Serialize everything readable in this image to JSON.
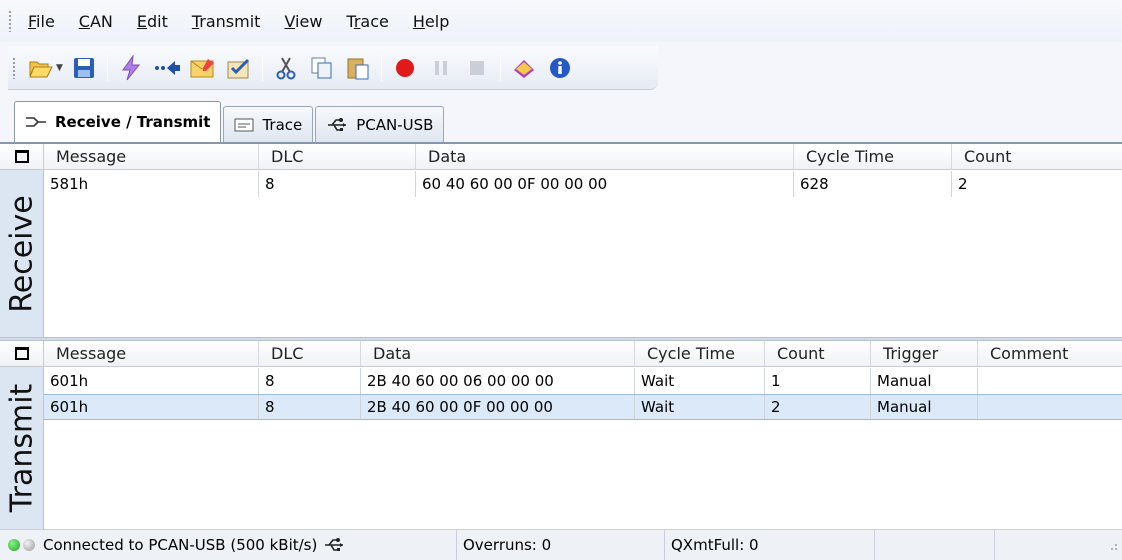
{
  "menu": [
    {
      "label": "File",
      "key": "F",
      "rest": "ile"
    },
    {
      "label": "CAN",
      "key": "C",
      "rest": "AN"
    },
    {
      "label": "Edit",
      "key": "E",
      "rest": "dit"
    },
    {
      "label": "Transmit",
      "key": "T",
      "rest": "ransmit"
    },
    {
      "label": "View",
      "key": "V",
      "rest": "iew"
    },
    {
      "label": "Trace",
      "key": "T",
      "rest": "race",
      "prefix": ""
    },
    {
      "label": "Help",
      "key": "H",
      "rest": "elp"
    }
  ],
  "menu_labels": {
    "file_key": "F",
    "file_rest": "ile",
    "can_key": "C",
    "can_rest": "AN",
    "edit_key": "E",
    "edit_rest": "dit",
    "transmit_key": "T",
    "transmit_rest": "ransmit",
    "view_key": "V",
    "view_rest": "iew",
    "trace_pre": "T",
    "trace_key": "r",
    "trace_rest": "ace",
    "help_key": "H",
    "help_rest": "elp"
  },
  "toolbar": {
    "icons": [
      "open-icon",
      "save-icon",
      "connect-icon",
      "new-message-icon",
      "edit-message-icon",
      "properties-icon",
      "cut-icon",
      "copy-icon",
      "paste-icon",
      "record-icon",
      "pause-icon",
      "stop-icon",
      "help-book-icon",
      "info-icon"
    ]
  },
  "tabs": [
    {
      "label": "Receive / Transmit",
      "icon": "receive-transmit-icon",
      "active": true
    },
    {
      "label": "Trace",
      "icon": "trace-icon",
      "active": false
    },
    {
      "label": "PCAN-USB",
      "icon": "usb-icon",
      "active": false
    }
  ],
  "receive": {
    "side_label": "Receive",
    "columns": [
      "Message",
      "DLC",
      "Data",
      "Cycle Time",
      "Count"
    ],
    "rows": [
      {
        "message": "581h",
        "dlc": "8",
        "data": "60 40 60 00 0F 00 00 00",
        "cycle": "628",
        "count": "2"
      }
    ]
  },
  "transmit": {
    "side_label": "Transmit",
    "columns": [
      "Message",
      "DLC",
      "Data",
      "Cycle Time",
      "Count",
      "Trigger",
      "Comment"
    ],
    "rows": [
      {
        "message": "601h",
        "dlc": "8",
        "data": "2B 40 60 00 06 00 00 00",
        "cycle": "Wait",
        "count": "1",
        "trigger": "Manual",
        "comment": ""
      },
      {
        "message": "601h",
        "dlc": "8",
        "data": "2B 40 60 00 0F 00 00 00",
        "cycle": "Wait",
        "count": "2",
        "trigger": "Manual",
        "comment": ""
      }
    ]
  },
  "status": {
    "connection": "Connected to PCAN-USB (500 kBit/s)",
    "overruns": "Overruns: 0",
    "qxmtfull": "QXmtFull: 0"
  },
  "colors": {
    "accent": "#3a79c6",
    "selected_row": "#dbe9f8",
    "led_green": "#27b827",
    "record_red": "#e11919"
  }
}
